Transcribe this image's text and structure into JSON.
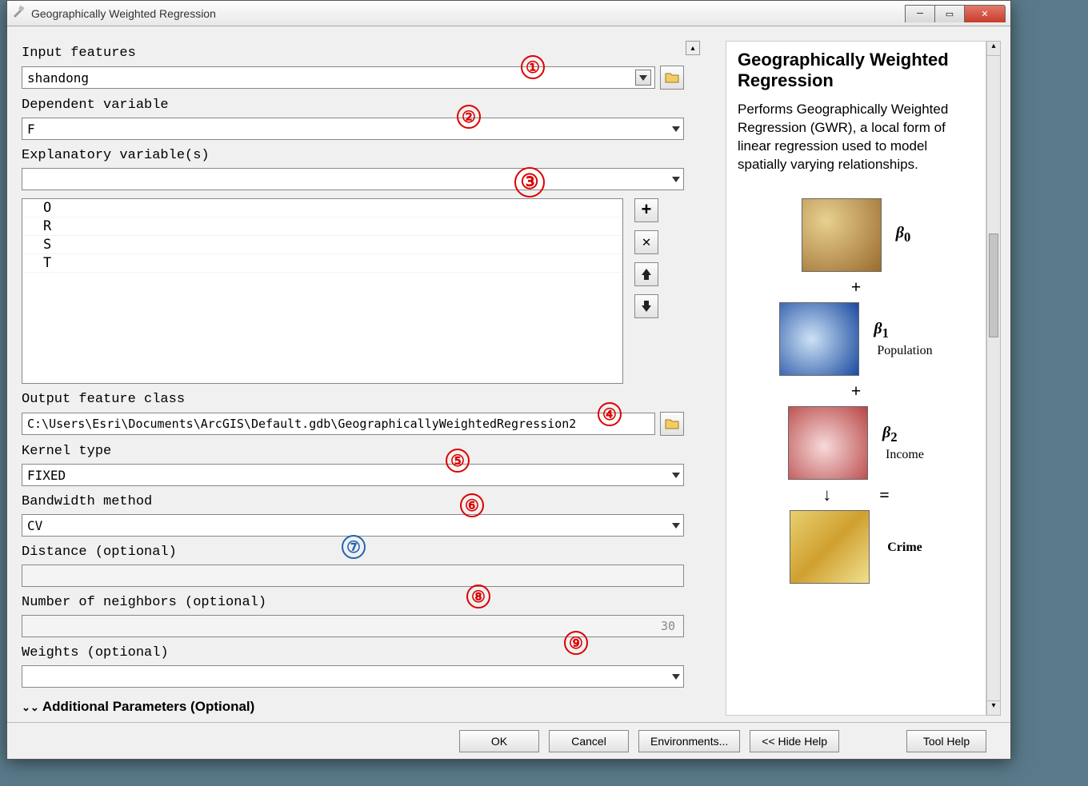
{
  "window": {
    "title": "Geographically Weighted Regression"
  },
  "labels": {
    "input_features": "Input features",
    "dependent_variable": "Dependent variable",
    "explanatory_variables": "Explanatory variable(s)",
    "output_feature_class": "Output feature class",
    "kernel_type": "Kernel type",
    "bandwidth_method": "Bandwidth method",
    "distance": "Distance (optional)",
    "neighbors": "Number of neighbors (optional)",
    "weights": "Weights (optional)",
    "additional": "Additional Parameters (Optional)"
  },
  "values": {
    "input_features": "shandong",
    "dependent_variable": "F",
    "explanatory_selected": "",
    "explanatory_list": [
      "O",
      "R",
      "S",
      "T"
    ],
    "output_feature_class": "C:\\Users\\Esri\\Documents\\ArcGIS\\Default.gdb\\GeographicallyWeightedRegression2",
    "kernel_type": "FIXED",
    "bandwidth_method": "CV",
    "distance": "",
    "neighbors": "30",
    "weights": ""
  },
  "buttons": {
    "ok": "OK",
    "cancel": "Cancel",
    "environments": "Environments...",
    "hide_help": "<< Hide Help",
    "tool_help": "Tool Help"
  },
  "help": {
    "title": "Geographically Weighted Regression",
    "body": "Performs Geographically Weighted Regression (GWR), a local form of linear regression used to model spatially varying relationships.",
    "beta0": "β0",
    "beta1": "β1",
    "pop": "Population",
    "beta2": "β2",
    "income": "Income",
    "crime": "Crime",
    "plus": "+",
    "eq": "="
  },
  "annotations": [
    "①",
    "②",
    "③",
    "④",
    "⑤",
    "⑥",
    "⑦",
    "⑧",
    "⑨"
  ]
}
